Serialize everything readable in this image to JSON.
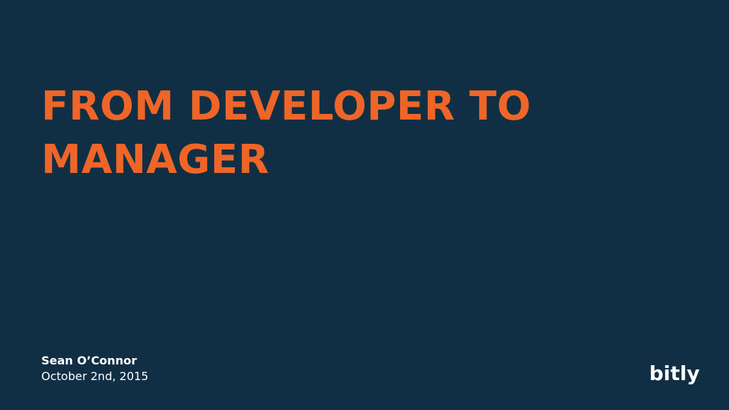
{
  "slide": {
    "title_lines": [
      "FROM DEVELOPER TO",
      "MANAGER"
    ],
    "author": "Sean O’Connor",
    "date": "October 2nd, 2015",
    "logo_text": "bitly"
  },
  "colors": {
    "background": "#112f44",
    "title": "#ef6528",
    "text": "#ffffff"
  },
  "icons": {
    "logo": "bitly-logo"
  }
}
